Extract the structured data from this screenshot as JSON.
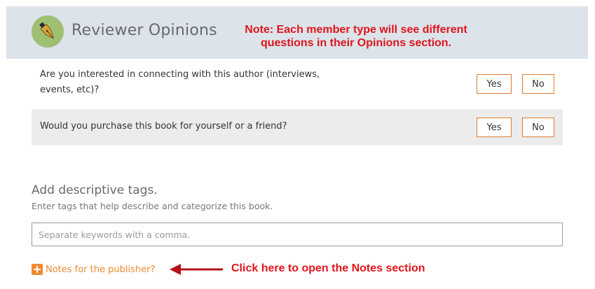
{
  "header": {
    "title": "Reviewer Opinions",
    "logo_icon": "fountain-pen-icon"
  },
  "note_callout": {
    "line1": "Note: Each member type will see different",
    "line2": "questions in their Opinions section."
  },
  "questions": [
    {
      "text": "Are you interested in connecting with this author (interviews, events, etc)?",
      "yes_label": "Yes",
      "no_label": "No"
    },
    {
      "text": "Would you purchase this book for yourself or a friend?",
      "yes_label": "Yes",
      "no_label": "No"
    }
  ],
  "tags": {
    "heading": "Add descriptive tags.",
    "subtext": "Enter tags that help describe and categorize this book.",
    "placeholder": "Separate keywords with a comma.",
    "value": ""
  },
  "notes": {
    "label": "Notes for the publisher?",
    "icon": "plus-square-icon"
  },
  "click_callout": {
    "text": "Click here to open the Notes section",
    "icon": "arrow-left-icon"
  },
  "colors": {
    "accent_orange": "#ef8a2f",
    "annotation_red": "#e0151b",
    "header_bg": "#dce3ea",
    "logo_green": "#9fbf72",
    "row_alt_bg": "#ececec"
  }
}
